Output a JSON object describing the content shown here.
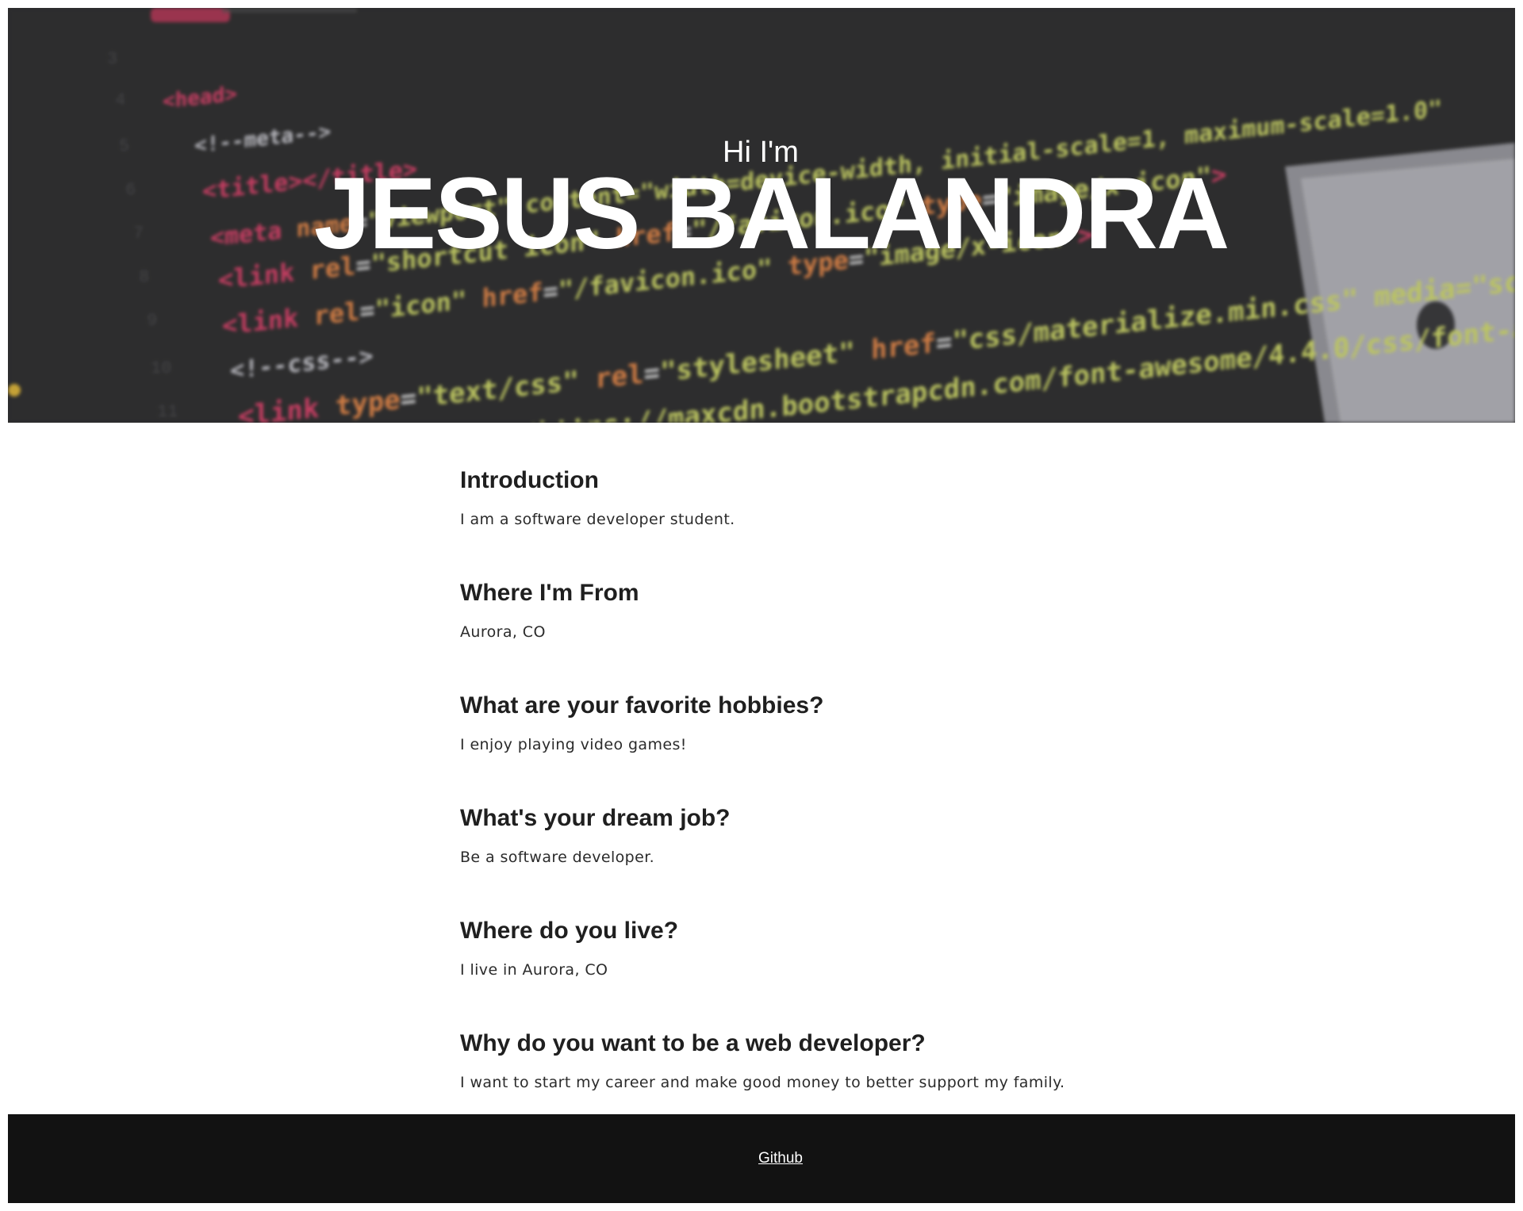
{
  "hero": {
    "greeting": "Hi I'm",
    "name": "JESUS BALANDRA",
    "background_image": "blurred-html-code-editor"
  },
  "sections": [
    {
      "heading": "Introduction",
      "text": "I am a software developer student."
    },
    {
      "heading": "Where I'm From",
      "text": "Aurora, CO"
    },
    {
      "heading": "What are your favorite hobbies?",
      "text": "I enjoy playing video games!"
    },
    {
      "heading": "What's your dream job?",
      "text": "Be a software developer."
    },
    {
      "heading": "Where do you live?",
      "text": "I live in Aurora, CO"
    },
    {
      "heading": "Why do you want to be a web developer?",
      "text": "I want to start my career and make good money to better support my family."
    }
  ],
  "footer": {
    "link_label": "Github"
  },
  "colors": {
    "hero_bg": "#2f2f30",
    "heading": "#1f1f1f",
    "body_text": "#2b2b2b",
    "footer_bg": "#121212",
    "footer_link": "#ffffff"
  }
}
